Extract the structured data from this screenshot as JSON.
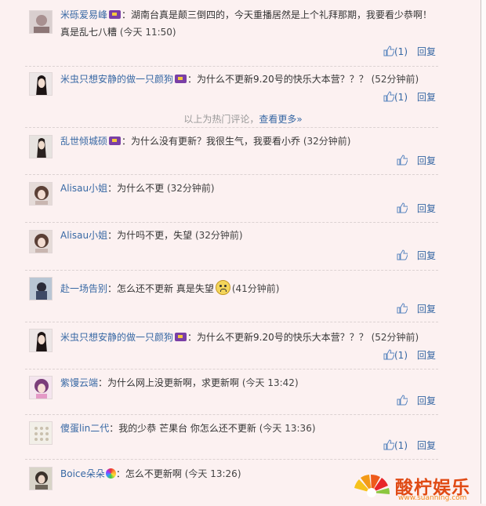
{
  "comments": [
    {
      "user": "米砾爱易峰",
      "badge": "vip",
      "content": "：湖南台真是颠三倒四的，今天重播居然是上个礼拜那期，我要看少恭啊！真是乱七八糟",
      "time": "(今天 11:50)",
      "likes": "(1)",
      "reply": "回复"
    },
    {
      "user": "米虫只想安静的做一只颜狗",
      "badge": "vip",
      "content": "：为什么不更新9.20号的快乐大本营？？？",
      "time": "(52分钟前)",
      "likes": "(1)",
      "reply": "回复"
    },
    {
      "user": "乱世倾城硕",
      "badge": "vip",
      "content": "：为什么没有更新？我很生气，我要看小乔",
      "time": "(32分钟前)",
      "likes": "",
      "reply": "回复"
    },
    {
      "user": "Alisau小姐",
      "badge": "",
      "content": "：为什么不更",
      "time": "(32分钟前)",
      "likes": "",
      "reply": "回复"
    },
    {
      "user": "Alisau小姐",
      "badge": "",
      "content": "：为什吗不更，失望",
      "time": "(32分钟前)",
      "likes": "",
      "reply": "回复"
    },
    {
      "user": "赴一场告别",
      "badge": "",
      "content": "：怎么还不更新 真是失望",
      "emoticon": "crying-face",
      "time": "(41分钟前)",
      "likes": "",
      "reply": "回复"
    },
    {
      "user": "米虫只想安静的做一只颜狗",
      "badge": "vip",
      "content": "：为什么不更新9.20号的快乐大本营？？？",
      "time": "(52分钟前)",
      "likes": "(1)",
      "reply": "回复"
    },
    {
      "user": "紫馒云端",
      "badge": "",
      "content": "：为什么网上没更新啊，求更新啊",
      "time": "(今天 13:42)",
      "likes": "",
      "reply": "回复"
    },
    {
      "user": "傻蛋lin二代",
      "badge": "",
      "content": "：我的少恭 芒果台 你怎么还不更新",
      "time": "(今天 13:36)",
      "likes": "(1)",
      "reply": "回复"
    },
    {
      "user": "Boice朵朵",
      "badge": "rainbow",
      "content": "：怎么不更新啊",
      "time": "(今天 13:26)",
      "likes": "",
      "reply": ""
    }
  ],
  "divider": {
    "text": "以上为热门评论，",
    "more": "查看更多»"
  },
  "watermark": {
    "text": "酸柠娱乐",
    "url": "www.suanning.com"
  },
  "colors": {
    "background": "#fcf1f1",
    "link": "#3768a4",
    "text": "#333333",
    "watermark": "#e04a14"
  }
}
